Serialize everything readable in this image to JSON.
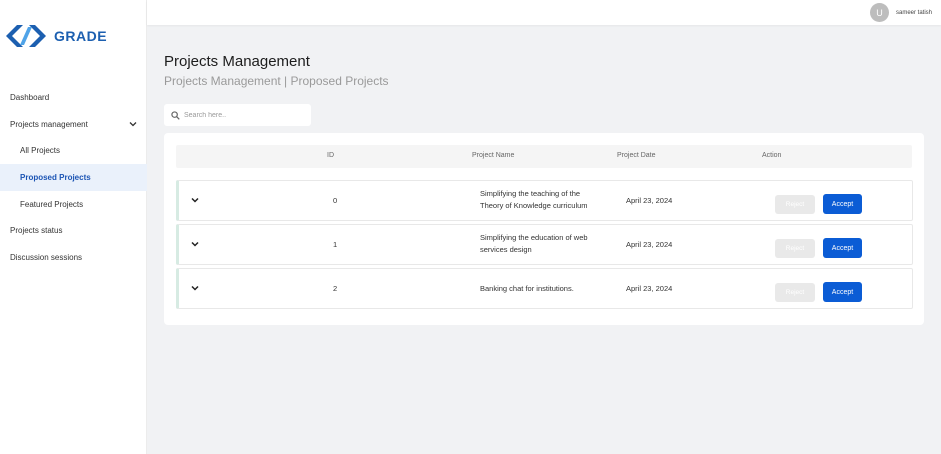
{
  "app": {
    "brand": "GRADE"
  },
  "sidebar": {
    "items": [
      {
        "label": "Dashboard"
      },
      {
        "label": "Projects management"
      },
      {
        "label": "All Projects"
      },
      {
        "label": "Proposed Projects"
      },
      {
        "label": "Featured Projects"
      },
      {
        "label": "Projects status"
      },
      {
        "label": "Discussion sessions"
      }
    ]
  },
  "header": {
    "avatar_initial": "U",
    "username": "sameer tatish"
  },
  "page": {
    "title": "Projects Management",
    "subtitle": "Projects Management | Proposed Projects"
  },
  "search": {
    "placeholder": "Search here.."
  },
  "table": {
    "columns": [
      "ID",
      "Project Name",
      "Project Date",
      "Action"
    ],
    "rows": [
      {
        "id": "0",
        "name_line1": "Simplifying the teaching of the",
        "name_line2": "Theory of Knowledge curriculum",
        "date": "April 23, 2024",
        "reject": "Reject",
        "accept": "Accept"
      },
      {
        "id": "1",
        "name_line1": "Simplifying the education of web",
        "name_line2": "services design",
        "date": "April 23, 2024",
        "reject": "Reject",
        "accept": "Accept"
      },
      {
        "id": "2",
        "name_line1": "Banking chat for institutions.",
        "name_line2": "",
        "date": "April 23, 2024",
        "reject": "Reject",
        "accept": "Accept"
      }
    ]
  },
  "colors": {
    "accent": "#0b5cd5",
    "active_nav_bg": "#eaf1fb",
    "logo": "#1c5fb0",
    "background": "#f1f2f4"
  },
  "icons": {
    "logo": "code-brackets-icon",
    "nav_expand": "chevron-down-icon",
    "search": "search-icon",
    "row_expand": "chevron-down-icon"
  }
}
